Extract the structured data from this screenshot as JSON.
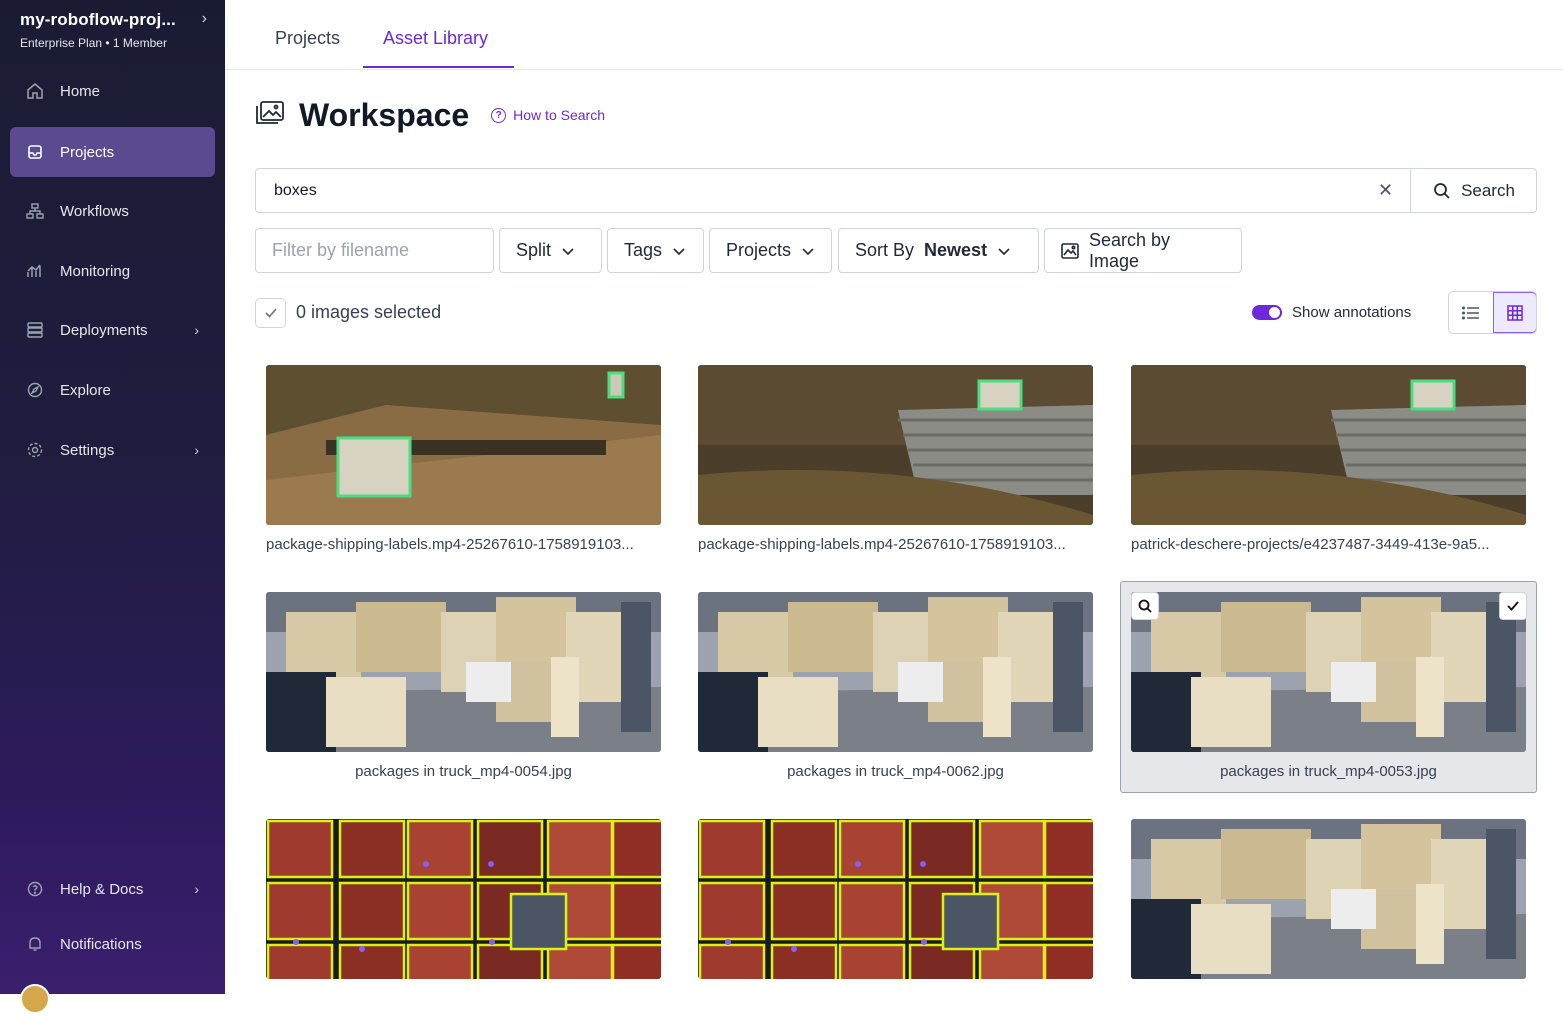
{
  "workspace": {
    "name": "my-roboflow-proj...",
    "plan": "Enterprise Plan",
    "members": "1 Member"
  },
  "nav": [
    {
      "label": "Home",
      "icon": "home-icon",
      "active": false
    },
    {
      "label": "Projects",
      "icon": "inbox-icon",
      "active": true
    },
    {
      "label": "Workflows",
      "icon": "workflow-icon",
      "active": false
    },
    {
      "label": "Monitoring",
      "icon": "chart-icon",
      "active": false
    },
    {
      "label": "Deployments",
      "icon": "server-icon",
      "active": false
    },
    {
      "label": "Explore",
      "icon": "compass-icon",
      "active": false
    },
    {
      "label": "Settings",
      "icon": "gear-icon",
      "active": false
    }
  ],
  "nav_bottom": [
    {
      "label": "Help & Docs",
      "icon": "help-icon"
    },
    {
      "label": "Notifications",
      "icon": "bell-icon"
    }
  ],
  "tabs": [
    {
      "label": "Projects"
    },
    {
      "label": "Asset Library",
      "active": true
    }
  ],
  "page": {
    "title": "Workspace",
    "how_to": "How to Search"
  },
  "search": {
    "value": "boxes",
    "button": "Search"
  },
  "filters": {
    "filename_placeholder": "Filter by filename",
    "split": "Split",
    "tags": "Tags",
    "projects": "Projects",
    "sort_label": "Sort By",
    "sort_value": "Newest",
    "search_by_image": "Search by Image"
  },
  "selection": {
    "text": "0 images selected",
    "show_annotations": "Show annotations",
    "annotations_on": true
  },
  "images": [
    {
      "name": "package-shipping-labels.mp4-25267610-1758919103...",
      "kind": "labels1"
    },
    {
      "name": "package-shipping-labels.mp4-25267610-1758919103...",
      "kind": "labels2"
    },
    {
      "name": "patrick-deschere-projects/e4237487-3449-413e-9a5...",
      "kind": "labels2"
    },
    {
      "name": "packages in truck_mp4-0054.jpg",
      "kind": "truck"
    },
    {
      "name": "packages in truck_mp4-0062.jpg",
      "kind": "truck"
    },
    {
      "name": "packages in truck_mp4-0053.jpg",
      "kind": "truck",
      "selected": true
    },
    {
      "name": "",
      "kind": "containers"
    },
    {
      "name": "",
      "kind": "containers"
    },
    {
      "name": "",
      "kind": "truck"
    }
  ],
  "colors": {
    "accent": "#6d28d9",
    "annotation_green": "#4ade80",
    "annotation_yellow": "#d9f212"
  }
}
